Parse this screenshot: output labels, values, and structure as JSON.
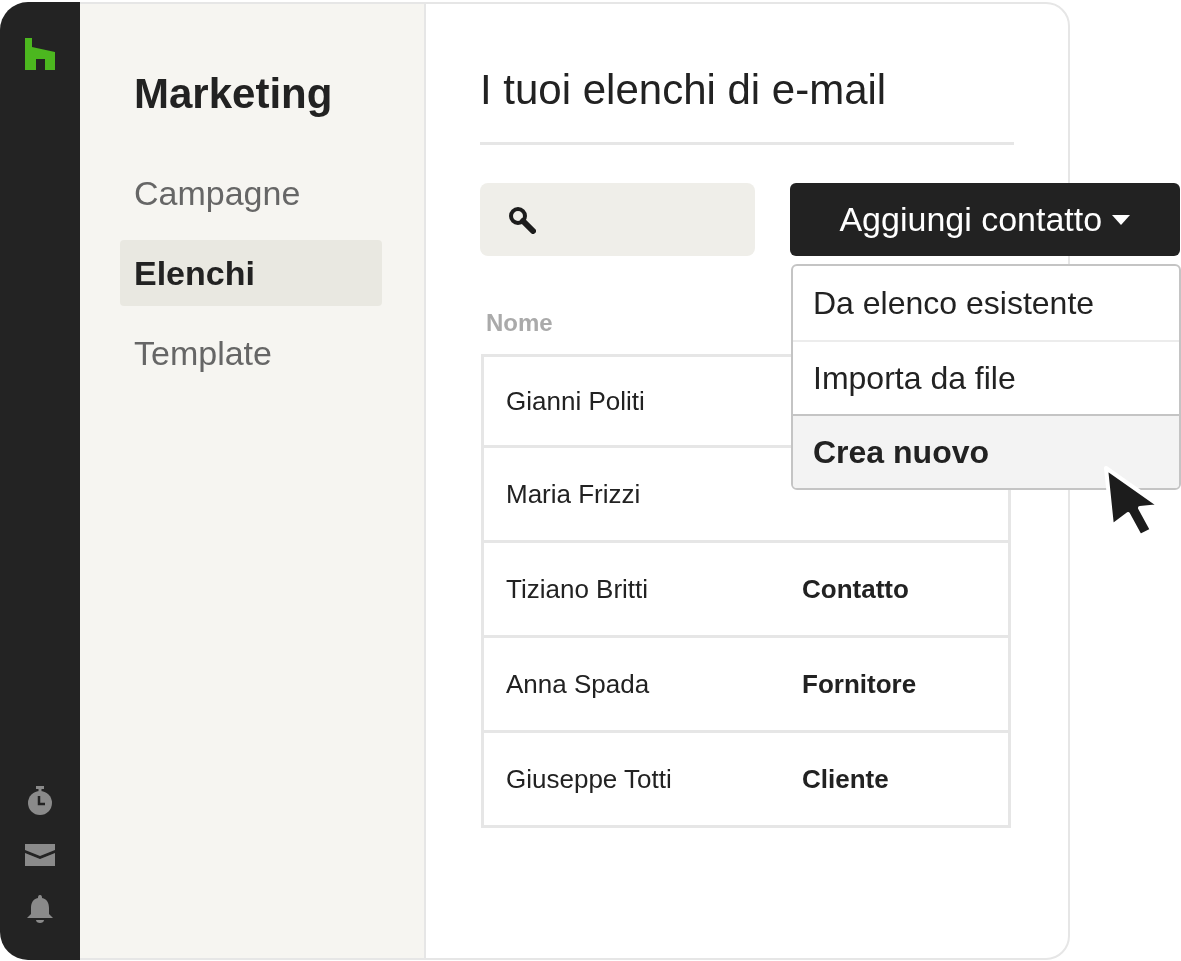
{
  "nav": {
    "title": "Marketing",
    "items": [
      {
        "label": "Campagne",
        "selected": false
      },
      {
        "label": "Elenchi",
        "selected": true
      },
      {
        "label": "Template",
        "selected": false
      }
    ]
  },
  "main": {
    "title": "I tuoi elenchi di e-mail",
    "add_button": {
      "label": "Aggiungi contatto",
      "expanded": true
    },
    "menu": [
      {
        "label": "Da elenco esistente",
        "selected": false
      },
      {
        "label": "Importa da file",
        "selected": false
      },
      {
        "label": "Crea nuovo",
        "selected": true
      }
    ],
    "table": {
      "columns": [
        "Nome"
      ],
      "rows": [
        {
          "name": "Gianni Politi"
        },
        {
          "name": "Maria Frizzi"
        },
        {
          "name": "Tiziano Britti",
          "type": "Contatto"
        },
        {
          "name": "Anna Spada",
          "type": "Fornitore"
        },
        {
          "name": "Giuseppe Totti",
          "type": "Cliente"
        }
      ]
    }
  }
}
